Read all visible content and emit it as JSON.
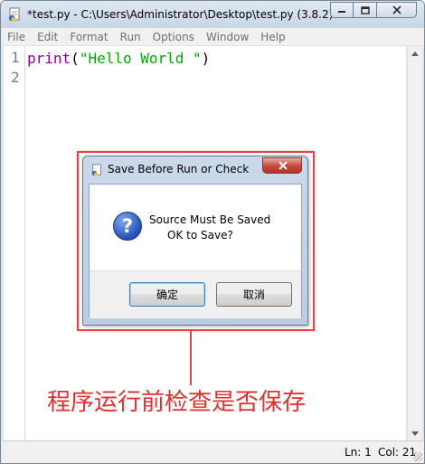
{
  "window": {
    "title": "*test.py - C:\\Users\\Administrator\\Desktop\\test.py (3.8.2)*"
  },
  "menu": [
    "File",
    "Edit",
    "Format",
    "Run",
    "Options",
    "Window",
    "Help"
  ],
  "editor": {
    "line_numbers": [
      "1",
      "2"
    ],
    "code": {
      "builtin": "print",
      "open": "(",
      "string": "\"Hello World \"",
      "close": ")"
    }
  },
  "status": {
    "line": "Ln: 1",
    "col": "Col: 21"
  },
  "dialog": {
    "title": "Save Before Run or Check",
    "message_line1": "Source Must Be Saved",
    "message_line2": "OK to Save?",
    "ok_label": "确定",
    "cancel_label": "取消",
    "question_glyph": "?"
  },
  "annotation": {
    "text": "程序运行前检查是否保存",
    "color": "#e03030"
  },
  "colors": {
    "builtin": "#900090",
    "string": "#00aa00",
    "line_number": "#7b7b7b",
    "menu_text": "#6f6f6f"
  }
}
